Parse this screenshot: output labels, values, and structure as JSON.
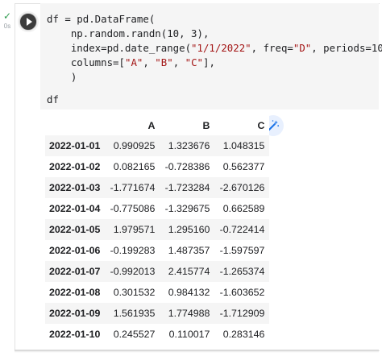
{
  "gutter": {
    "status_icon": "check-icon",
    "exec_time": "0s"
  },
  "run_button": {
    "icon": "play-icon"
  },
  "code": {
    "line1": "df = pd.DataFrame(",
    "line2": "    np.random.randn(10, 3),",
    "line3_pre": "    index=pd.date_range(",
    "line3_s1": "\"1/1/2022\"",
    "line3_mid": ", freq=",
    "line3_s2": "\"D\"",
    "line3_mid2": ", periods=",
    "line3_num": "10",
    "line3_post": "),",
    "line4_pre": "    columns=[",
    "line4_a": "\"A\"",
    "line4_sep1": ", ",
    "line4_b": "\"B\"",
    "line4_sep2": ", ",
    "line4_c": "\"C\"",
    "line4_post": "],",
    "line5": "    )",
    "line7": "df"
  },
  "output_toolbar": {
    "icon": "magic-wand-icon",
    "color": "#1a73e8"
  },
  "table": {
    "columns": [
      "A",
      "B",
      "C"
    ],
    "rows": [
      {
        "index": "2022-01-01",
        "values": [
          "0.990925",
          "1.323676",
          "1.048315"
        ]
      },
      {
        "index": "2022-01-02",
        "values": [
          "0.082165",
          "-0.728386",
          "0.562377"
        ]
      },
      {
        "index": "2022-01-03",
        "values": [
          "-1.771674",
          "-1.723284",
          "-2.670126"
        ]
      },
      {
        "index": "2022-01-04",
        "values": [
          "-0.775086",
          "-1.329675",
          "0.662589"
        ]
      },
      {
        "index": "2022-01-05",
        "values": [
          "1.979571",
          "1.295160",
          "-0.722414"
        ]
      },
      {
        "index": "2022-01-06",
        "values": [
          "-0.199283",
          "1.487357",
          "-1.597597"
        ]
      },
      {
        "index": "2022-01-07",
        "values": [
          "-0.992013",
          "2.415774",
          "-1.265374"
        ]
      },
      {
        "index": "2022-01-08",
        "values": [
          "0.301532",
          "0.984132",
          "-1.603652"
        ]
      },
      {
        "index": "2022-01-09",
        "values": [
          "1.561935",
          "1.774988",
          "-1.712909"
        ]
      },
      {
        "index": "2022-01-10",
        "values": [
          "0.245527",
          "0.110017",
          "0.283146"
        ]
      }
    ]
  }
}
